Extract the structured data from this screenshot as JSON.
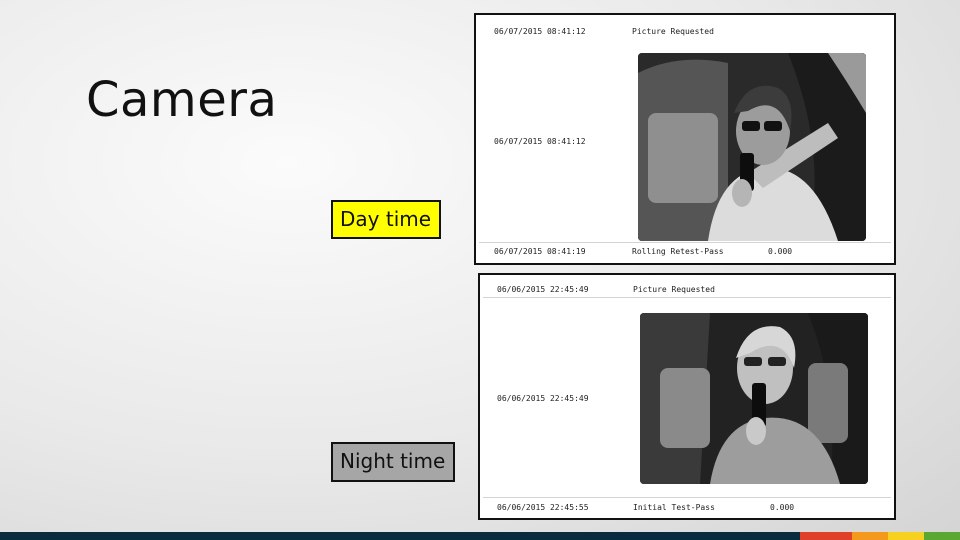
{
  "slide": {
    "title": "Camera"
  },
  "labels": {
    "day": "Day time",
    "night": "Night time"
  },
  "day_panel": {
    "rows": [
      {
        "time": "06/07/2015 08:41:12",
        "event": "Picture Requested",
        "value": ""
      },
      {
        "time": "06/07/2015 08:41:12",
        "event": "",
        "value": ""
      },
      {
        "time": "06/07/2015 08:41:19",
        "event": "Rolling Retest-Pass",
        "value": "0.000"
      }
    ]
  },
  "night_panel": {
    "rows": [
      {
        "time": "06/06/2015 22:45:49",
        "event": "Picture Requested",
        "value": ""
      },
      {
        "time": "06/06/2015 22:45:49",
        "event": "",
        "value": ""
      },
      {
        "time": "06/06/2015 22:45:55",
        "event": "Initial Test-Pass",
        "value": "0.000"
      }
    ]
  },
  "colors": {
    "day_label_bg": "#ffff00",
    "night_label_bg": "#a6a6a6",
    "bottom_bar": "#0a2a40",
    "accent_red": "#e0402a",
    "accent_orange": "#f39a1c",
    "accent_yellow": "#f7d11f",
    "accent_green": "#5aa832"
  }
}
